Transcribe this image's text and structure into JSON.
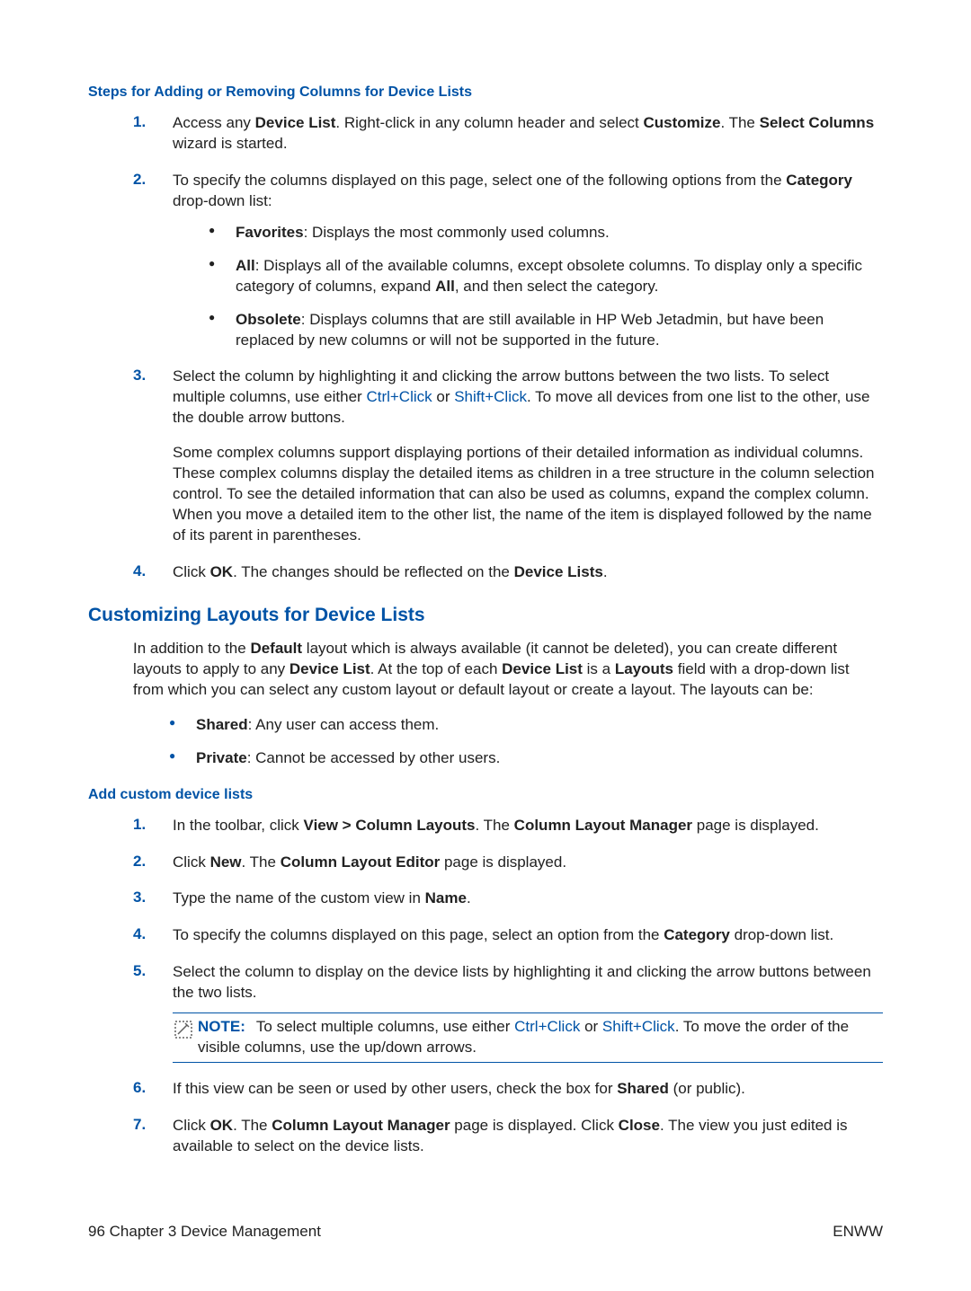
{
  "section1": {
    "title": "Steps for Adding or Removing Columns for Device Lists",
    "step1_a": "Access any ",
    "step1_b": "Device List",
    "step1_c": ". Right-click in any column header and select ",
    "step1_d": "Customize",
    "step1_e": ". The ",
    "step1_f": "Select Columns",
    "step1_g": " wizard is started.",
    "step2_a": "To specify the columns displayed on this page, select one of the following options from the ",
    "step2_b": "Category",
    "step2_c": " drop-down list:",
    "step2_bullets": {
      "fav_a": "Favorites",
      "fav_b": ": Displays the most commonly used columns.",
      "all_a": "All",
      "all_b": ": Displays all of the available columns, except obsolete columns. To display only a specific category of columns, expand ",
      "all_c": "All",
      "all_d": ", and then select the category.",
      "obs_a": "Obsolete",
      "obs_b": ": Displays columns that are still available in HP Web Jetadmin, but have been replaced by new columns or will not be supported in the future."
    },
    "step3_a": "Select the column by highlighting it and clicking the arrow buttons between the two lists. To select multiple columns, use either ",
    "step3_key1": "Ctrl+Click",
    "step3_b": " or ",
    "step3_key2": "Shift+Click",
    "step3_c": ". To move all devices from one list to the other, use the double arrow buttons.",
    "step3_para": "Some complex columns support displaying portions of their detailed information as individual columns. These complex columns display the detailed items as children in a tree structure in the column selection control. To see the detailed information that can also be used as columns, expand the complex column. When you move a detailed item to the other list, the name of the item is displayed followed by the name of its parent in parentheses.",
    "step4_a": "Click ",
    "step4_b": "OK",
    "step4_c": ". The changes should be reflected on the ",
    "step4_d": "Device Lists",
    "step4_e": "."
  },
  "section2": {
    "title": "Customizing Layouts for Device Lists",
    "intro_a": "In addition to the ",
    "intro_b": "Default",
    "intro_c": " layout which is always available (it cannot be deleted), you can create different layouts to apply to any ",
    "intro_d": "Device List",
    "intro_e": ". At the top of each ",
    "intro_f": "Device List",
    "intro_g": " is a ",
    "intro_h": "Layouts",
    "intro_i": " field with a drop-down list from which you can select any custom layout or default layout or create a layout. The layouts can be:",
    "shared_a": "Shared",
    "shared_b": ": Any user can access them.",
    "private_a": "Private",
    "private_b": ": Cannot be accessed by other users."
  },
  "section3": {
    "title": "Add custom device lists",
    "step1_a": "In the toolbar, click ",
    "step1_b": "View > Column Layouts",
    "step1_c": ". The ",
    "step1_d": "Column Layout Manager",
    "step1_e": " page is displayed.",
    "step2_a": "Click ",
    "step2_b": "New",
    "step2_c": ". The ",
    "step2_d": "Column Layout Editor",
    "step2_e": " page is displayed.",
    "step3_a": "Type the name of the custom view in ",
    "step3_b": "Name",
    "step3_c": ".",
    "step4_a": "To specify the columns displayed on this page, select an option from the ",
    "step4_b": "Category",
    "step4_c": " drop-down list.",
    "step5": "Select the column to display on the device lists by highlighting it and clicking the arrow buttons between the two lists.",
    "note_label": "NOTE:",
    "note_a": "To select multiple columns, use either ",
    "note_key1": "Ctrl+Click",
    "note_b": " or ",
    "note_key2": "Shift+Click",
    "note_c": ". To move the order of the visible columns, use the up/down arrows.",
    "step6_a": "If this view can be seen or used by other users, check the box for ",
    "step6_b": "Shared",
    "step6_c": " (or public).",
    "step7_a": "Click ",
    "step7_b": "OK",
    "step7_c": ". The ",
    "step7_d": "Column Layout Manager",
    "step7_e": " page is displayed. Click ",
    "step7_f": "Close",
    "step7_g": ". The view you just edited is available to select on the device lists."
  },
  "footer": {
    "left": "96    Chapter 3   Device Management",
    "right": "ENWW"
  }
}
